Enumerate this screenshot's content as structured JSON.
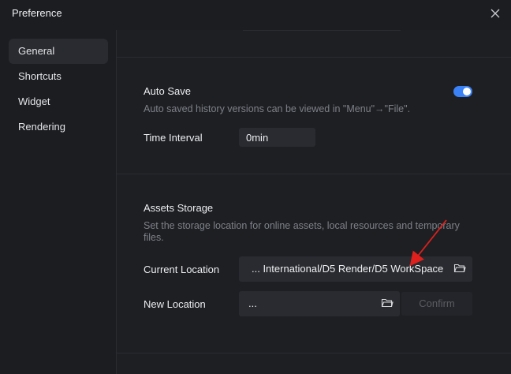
{
  "window": {
    "title": "Preference"
  },
  "sidebar": {
    "items": [
      {
        "label": "General",
        "active": true
      },
      {
        "label": "Shortcuts",
        "active": false
      },
      {
        "label": "Widget",
        "active": false
      },
      {
        "label": "Rendering",
        "active": false
      }
    ]
  },
  "auto_save": {
    "title": "Auto Save",
    "description": "Auto saved history versions can be viewed in \"Menu\"→\"File\".",
    "enabled": true,
    "time_interval_label": "Time Interval",
    "time_interval_value": "0min"
  },
  "assets_storage": {
    "title": "Assets Storage",
    "description_line1": "Set the storage location for online assets, local resources and temporary",
    "description_line2": "files.",
    "current_location_label": "Current Location",
    "current_location_value": "... International/D5 Render/D5 WorkSpace",
    "new_location_label": "New Location",
    "new_location_value": "...",
    "confirm_label": "Confirm"
  },
  "colors": {
    "background": "#1e1f23",
    "sidebar_active": "#2a2b30",
    "accent": "#3b82f6",
    "annotation_arrow": "#e0201c"
  },
  "icons": [
    "close-icon",
    "folder-icon",
    "toggle-switch"
  ]
}
